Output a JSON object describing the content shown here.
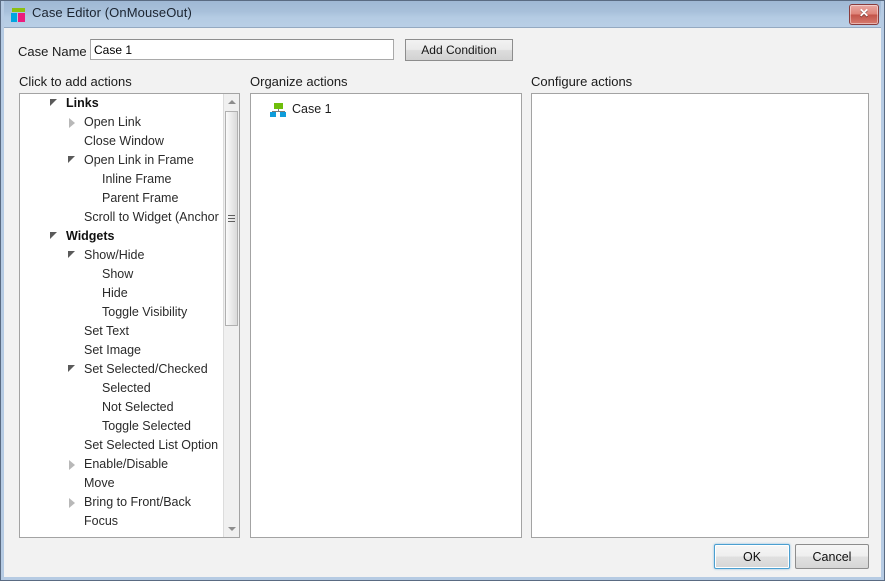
{
  "window": {
    "title": "Case Editor (OnMouseOut)",
    "icon": "axure-logo-icon",
    "close_label": "✕",
    "accent_color": "#b4cbe3",
    "close_color": "#c3544a"
  },
  "form": {
    "case_name_label": "Case Name",
    "case_name_value": "Case 1",
    "case_name_placeholder": "Case Name",
    "add_condition_label": "Add Condition"
  },
  "columns": {
    "left_heading": "Click to add actions",
    "middle_heading": "Organize actions",
    "right_heading": "Configure actions"
  },
  "action_tree": [
    {
      "label": "Links",
      "level": 0,
      "arrow": "expanded",
      "bold": true
    },
    {
      "label": "Open Link",
      "level": 1,
      "arrow": "collapsed",
      "bold": false
    },
    {
      "label": "Close Window",
      "level": 1,
      "arrow": "none",
      "bold": false
    },
    {
      "label": "Open Link in Frame",
      "level": 1,
      "arrow": "expanded",
      "bold": false
    },
    {
      "label": "Inline Frame",
      "level": 2,
      "arrow": "none",
      "bold": false
    },
    {
      "label": "Parent Frame",
      "level": 2,
      "arrow": "none",
      "bold": false
    },
    {
      "label": "Scroll to Widget (Anchor Link)",
      "level": 1,
      "arrow": "none",
      "bold": false
    },
    {
      "label": "Widgets",
      "level": 0,
      "arrow": "expanded",
      "bold": true
    },
    {
      "label": "Show/Hide",
      "level": 1,
      "arrow": "expanded",
      "bold": false
    },
    {
      "label": "Show",
      "level": 2,
      "arrow": "none",
      "bold": false
    },
    {
      "label": "Hide",
      "level": 2,
      "arrow": "none",
      "bold": false
    },
    {
      "label": "Toggle Visibility",
      "level": 2,
      "arrow": "none",
      "bold": false
    },
    {
      "label": "Set Text",
      "level": 1,
      "arrow": "none",
      "bold": false
    },
    {
      "label": "Set Image",
      "level": 1,
      "arrow": "none",
      "bold": false
    },
    {
      "label": "Set Selected/Checked",
      "level": 1,
      "arrow": "expanded",
      "bold": false
    },
    {
      "label": "Selected",
      "level": 2,
      "arrow": "none",
      "bold": false
    },
    {
      "label": "Not Selected",
      "level": 2,
      "arrow": "none",
      "bold": false
    },
    {
      "label": "Toggle Selected",
      "level": 2,
      "arrow": "none",
      "bold": false
    },
    {
      "label": "Set Selected List Option",
      "level": 1,
      "arrow": "none",
      "bold": false
    },
    {
      "label": "Enable/Disable",
      "level": 1,
      "arrow": "collapsed",
      "bold": false
    },
    {
      "label": "Move",
      "level": 1,
      "arrow": "none",
      "bold": false
    },
    {
      "label": "Bring to Front/Back",
      "level": 1,
      "arrow": "collapsed",
      "bold": false
    },
    {
      "label": "Focus",
      "level": 1,
      "arrow": "none",
      "bold": false
    }
  ],
  "organize": {
    "root_label": "Case 1",
    "root_icon": "case-hierarchy-icon"
  },
  "configure": {
    "content": ""
  },
  "footer": {
    "ok_label": "OK",
    "cancel_label": "Cancel"
  }
}
